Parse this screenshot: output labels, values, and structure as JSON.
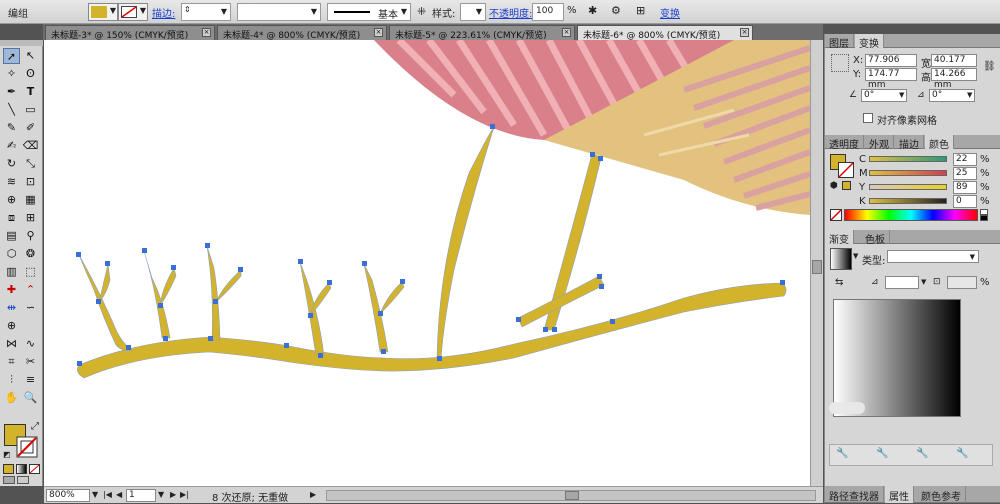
{
  "control_bar": {
    "selection_label": "编组",
    "fill_color": "#d4b32c",
    "stroke_label": "描边:",
    "stroke_profile": "基本",
    "style_label": "样式:",
    "opacity_label": "不透明度:",
    "opacity_value": "100",
    "opacity_unit": "%",
    "transform_link": "变换"
  },
  "doc_tabs": [
    {
      "label": "未标题-3* @ 150% (CMYK/预览)",
      "close": "×"
    },
    {
      "label": "未标题-4* @ 800% (CMYK/预览)",
      "close": "×"
    },
    {
      "label": "未标题-5* @ 223.61% (CMYK/预览)",
      "close": "×"
    },
    {
      "label": "未标题-6* @ 800% (CMYK/预览)",
      "close": "×"
    }
  ],
  "status": {
    "zoom": "800%",
    "page": "1",
    "message": "8 次还原; 无重做"
  },
  "transform_panel": {
    "tabs": [
      "图层",
      "变换"
    ],
    "x_label": "X:",
    "x_value": "77.906 mm",
    "w_label": "宽:",
    "w_value": "40.177 mm",
    "y_label": "Y:",
    "y_value": "174.77 mm",
    "h_label": "高:",
    "h_value": "14.266 mm",
    "rotate_value": "0°",
    "shear_value": "0°",
    "pixel_grid_label": "对齐像素网格"
  },
  "color_panel": {
    "tabs": [
      "透明度",
      "外观",
      "描边",
      "颜色"
    ],
    "channels": [
      {
        "name": "C",
        "value": "22",
        "unit": "%"
      },
      {
        "name": "M",
        "value": "25",
        "unit": "%"
      },
      {
        "name": "Y",
        "value": "89",
        "unit": "%"
      },
      {
        "name": "K",
        "value": "0",
        "unit": "%"
      }
    ],
    "fill_color": "#d4b32c"
  },
  "gradient_panel": {
    "tabs": [
      "渐变",
      "色板"
    ],
    "type_label": "类型:",
    "percent_unit": "%"
  },
  "bottom_panel": {
    "tabs": [
      "路径查找器",
      "属性",
      "颜色参考"
    ]
  },
  "artwork": {
    "branch_color": "#d4b32c",
    "pink_color": "#d9808a",
    "tan_color": "#e2c27e",
    "anchor_color": "#3b6fd8"
  }
}
